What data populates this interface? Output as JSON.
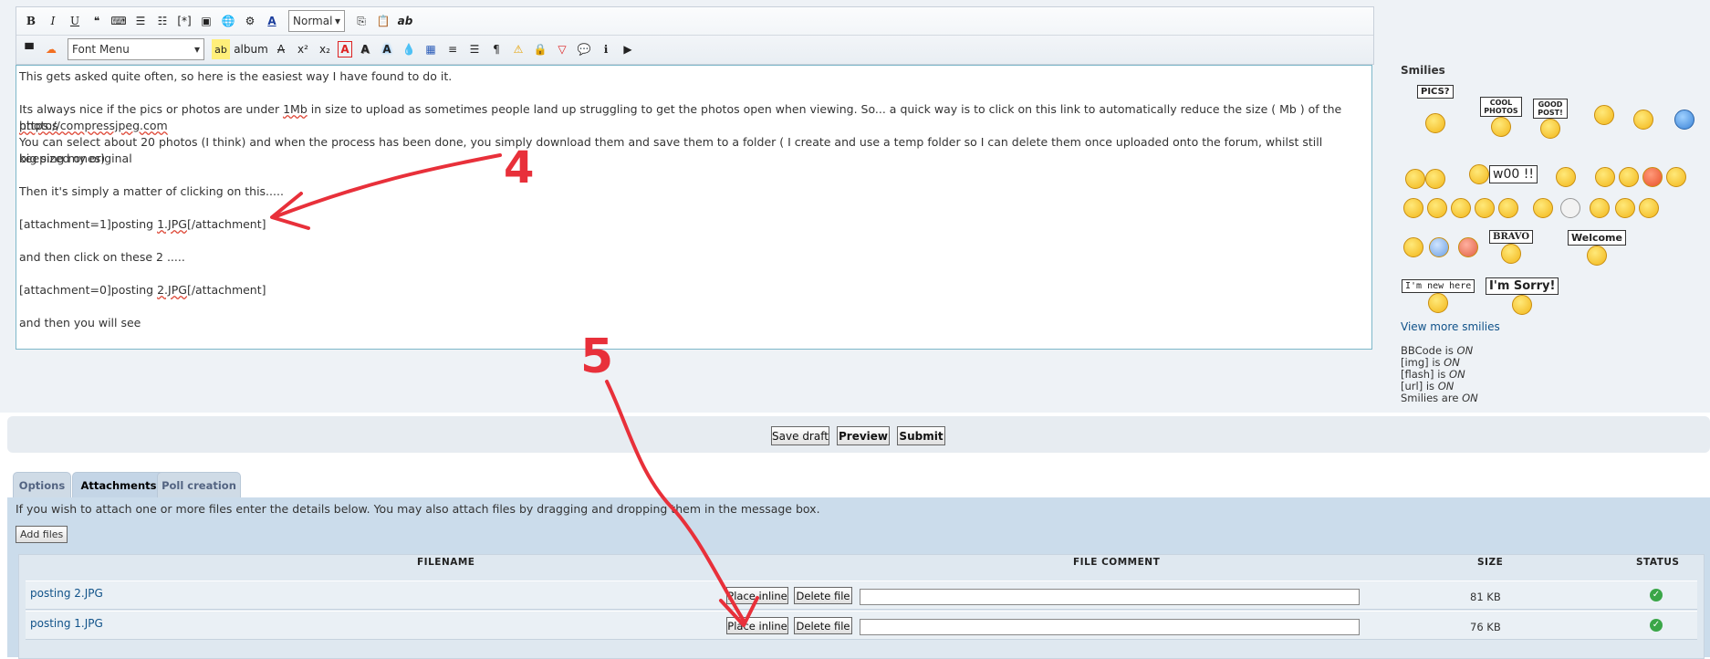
{
  "toolbar": {
    "row1": [
      {
        "name": "bold-button",
        "label": "B"
      },
      {
        "name": "italic-button",
        "label": "I"
      },
      {
        "name": "underline-button",
        "label": "U"
      },
      {
        "name": "quote-button",
        "label": "❝"
      },
      {
        "name": "code-button",
        "label": "⌨"
      },
      {
        "name": "bullet-list-button",
        "label": "☰"
      },
      {
        "name": "numbered-list-button",
        "label": "☷"
      },
      {
        "name": "list-item-button",
        "label": "[*]"
      },
      {
        "name": "image-button",
        "label": "▣"
      },
      {
        "name": "link-button",
        "label": "🌐"
      },
      {
        "name": "flash-button",
        "label": "⚙"
      },
      {
        "name": "font-color-button",
        "label": "A"
      }
    ],
    "size_select": "Normal",
    "row1_tail": [
      {
        "name": "copy-button",
        "label": "⎘"
      },
      {
        "name": "paste-button",
        "label": "📋"
      },
      {
        "name": "spellcheck-button",
        "label": "ab"
      }
    ],
    "row2_lead": [
      {
        "name": "flag-icon",
        "label": "▀"
      },
      {
        "name": "soundcloud-icon",
        "label": "☁"
      }
    ],
    "font_select": "Font Menu",
    "row2_tail": [
      {
        "name": "highlight-button",
        "label": "ab"
      },
      {
        "name": "album-button",
        "label": "album"
      },
      {
        "name": "strike-button",
        "label": "A"
      },
      {
        "name": "superscript-button",
        "label": "x²"
      },
      {
        "name": "subscript-button",
        "label": "x₂"
      },
      {
        "name": "outline-text-button",
        "label": "A"
      },
      {
        "name": "shadow-text-button",
        "label": "A"
      },
      {
        "name": "glow-text-button",
        "label": "A"
      },
      {
        "name": "drop-button",
        "label": "💧"
      },
      {
        "name": "gradient-button",
        "label": "▦"
      },
      {
        "name": "align-center-button",
        "label": "≡"
      },
      {
        "name": "align-justify-button",
        "label": "☰"
      },
      {
        "name": "direction-button",
        "label": "¶"
      },
      {
        "name": "warning-icon",
        "label": "⚠"
      },
      {
        "name": "lock-icon",
        "label": "🔒"
      },
      {
        "name": "spoiler-button",
        "label": "▽"
      },
      {
        "name": "speech-icon",
        "label": "💬"
      },
      {
        "name": "info-icon",
        "label": "ℹ"
      },
      {
        "name": "play-icon",
        "label": "▶"
      }
    ]
  },
  "editor": {
    "line1": "This gets asked quite often, so here is the easiest way I have found to do it.",
    "line2a": "Its always nice if the pics or photos are under ",
    "line2b": "1Mb",
    "line2c": " in size to upload as sometimes people land up struggling to get the photos open when viewing. So... a quick way is to click on this link to automatically reduce the size ( Mb ) of the photos",
    "line3": "https://compressjpeg.com",
    "line4": "You can select about 20 photos (I think) and when the process has been done, you simply download them and save them to a folder ( I create and use a temp folder so I can delete them once uploaded onto the forum, whilst still keeping my original",
    "line5": "big sized ones)",
    "line6": "Then it's simply a matter of clicking on this.....",
    "line7a": "[attachment=1]posting ",
    "line7b": "1.JPG",
    "line7c": "[/attachment]",
    "line8": "and then click on these 2 .....",
    "line9a": "[attachment=0]posting ",
    "line9b": "2.JPG",
    "line9c": "[/attachment]",
    "line10": "and then you will see"
  },
  "annotations": {
    "n4": "4",
    "n5": "5",
    "color": "#e8303a"
  },
  "smilies": {
    "title": "Smilies",
    "signs": [
      "PICS?",
      "COOL PHOTOS",
      "GOOD POST!",
      "w00 !!",
      "BRAVO",
      "Welcome",
      "I'm new here",
      "I'm Sorry!"
    ],
    "view_more": "View more smilies",
    "bbcode": {
      "l1a": "BBCode is ",
      "l1b": "ON",
      "l2a": "[img] is ",
      "l2b": "ON",
      "l3a": "[flash] is ",
      "l3b": "ON",
      "l4a": "[url] is ",
      "l4b": "ON",
      "l5a": "Smilies are ",
      "l5b": "ON"
    }
  },
  "buttons": {
    "save_draft": "Save draft",
    "preview": "Preview",
    "submit": "Submit"
  },
  "tabs": {
    "options": "Options",
    "attachments": "Attachments",
    "poll": "Poll creation"
  },
  "attachments": {
    "help": "If you wish to attach one or more files enter the details below. You may also attach files by dragging and dropping them in the message box.",
    "add_files": "Add files",
    "headers": {
      "filename": "FILENAME",
      "comment": "FILE COMMENT",
      "size": "SIZE",
      "status": "STATUS"
    },
    "rows": [
      {
        "name": "posting 2.JPG",
        "place": "Place inline",
        "delete": "Delete file",
        "size": "81 KB",
        "status": "✓"
      },
      {
        "name": "posting 1.JPG",
        "place": "Place inline",
        "delete": "Delete file",
        "size": "76 KB",
        "status": "✓"
      }
    ]
  }
}
